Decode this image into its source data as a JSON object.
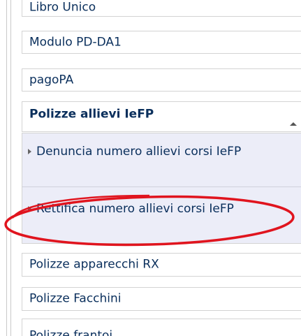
{
  "menu": {
    "items_top": [
      {
        "label": "Libro Unico"
      },
      {
        "label": "Modulo PD-DA1"
      },
      {
        "label": "pagoPA"
      }
    ],
    "open_section": {
      "label": "Polizze allievi IeFP",
      "submenu": [
        {
          "label": "Denuncia numero allievi corsi IeFP"
        },
        {
          "label": "Rettifica numero allievi corsi IeFP"
        }
      ]
    },
    "items_bottom": [
      {
        "label": "Polizze apparecchi RX"
      },
      {
        "label": "Polizze Facchini"
      },
      {
        "label": "Polizze frantoi"
      }
    ]
  },
  "annotation": {
    "color": "#e0141e",
    "target": "Rettifica numero allievi corsi IeFP"
  },
  "icons": {
    "submenu_bullet": "triangle-right-icon",
    "collapse": "chevron-up-icon"
  }
}
